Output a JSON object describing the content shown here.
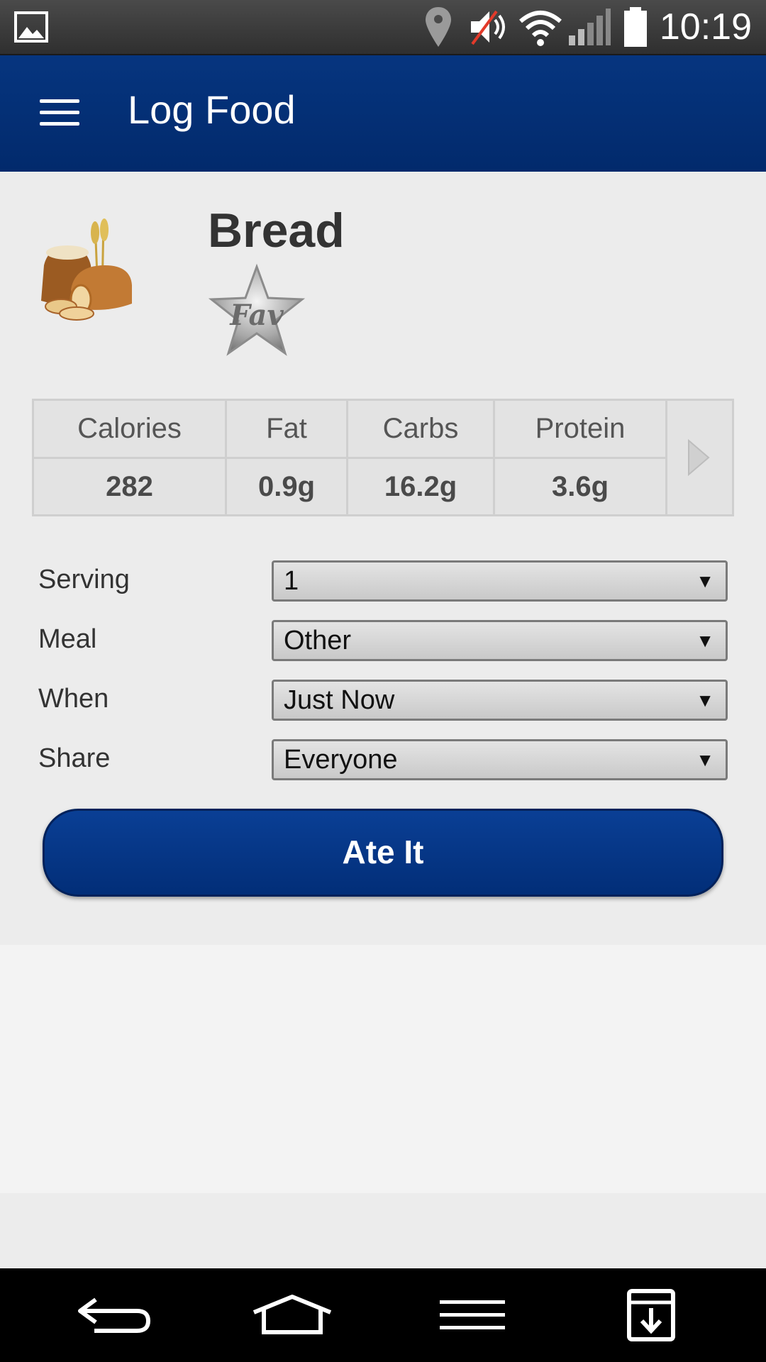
{
  "status_bar": {
    "time": "10:19",
    "icons": [
      "image-icon",
      "location-icon",
      "muted-volume-icon",
      "wifi-icon",
      "signal-icon",
      "battery-icon"
    ]
  },
  "header": {
    "title": "Log Food",
    "menu_icon": "hamburger-menu-icon",
    "bg_color": "#022a6c"
  },
  "food": {
    "name": "Bread",
    "image_icon": "bread-food-icon",
    "fav_label": "Fav"
  },
  "nutrition": {
    "columns": [
      {
        "label": "Calories",
        "value": "282"
      },
      {
        "label": "Fat",
        "value": "0.9g"
      },
      {
        "label": "Carbs",
        "value": "16.2g"
      },
      {
        "label": "Protein",
        "value": "3.6g"
      }
    ],
    "next_icon": "next-arrow-icon"
  },
  "form": {
    "serving": {
      "label": "Serving",
      "value": "1"
    },
    "meal": {
      "label": "Meal",
      "value": "Other"
    },
    "when": {
      "label": "When",
      "value": "Just Now"
    },
    "share": {
      "label": "Share",
      "value": "Everyone"
    }
  },
  "action": {
    "ate_it_label": "Ate It",
    "color": "#06357f"
  },
  "nav_bar": {
    "icons": [
      "back-icon",
      "home-icon",
      "menu-icon",
      "download-icon"
    ]
  }
}
